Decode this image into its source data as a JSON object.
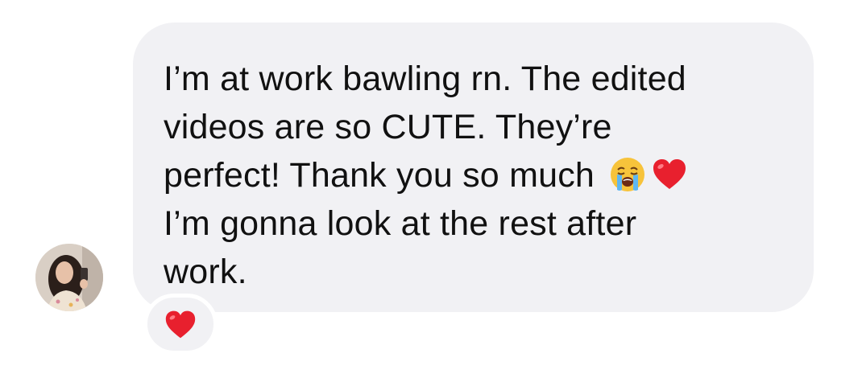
{
  "message": {
    "lines": [
      "I’m at work bawling rn. The edited",
      "videos are so CUTE. They’re",
      "perfect! Thank you so much",
      "I’m gonna look at the rest after",
      "work."
    ],
    "inline_emojis": [
      "loudly-crying-face",
      "red-heart"
    ]
  },
  "reaction": {
    "emoji": "red-heart"
  },
  "colors": {
    "bubble": "#f1f1f4",
    "text": "#111111",
    "heart": "#e8202e",
    "background": "#ffffff"
  }
}
